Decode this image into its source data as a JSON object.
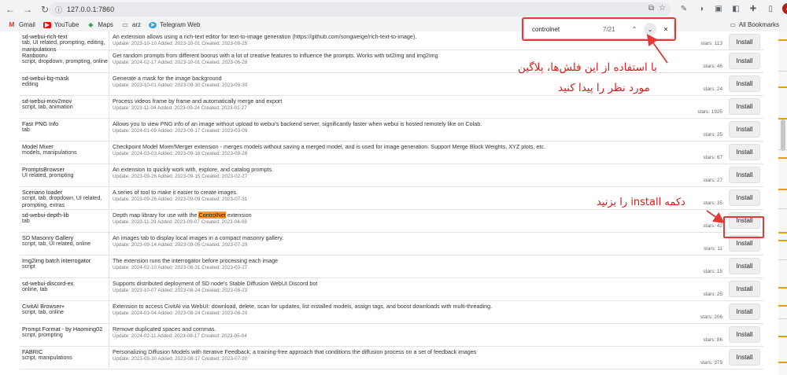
{
  "browser": {
    "url": "127.0.0.1:7860",
    "bookmarks": [
      "Gmail",
      "YouTube",
      "Maps",
      "arz",
      "Telegram Web"
    ],
    "all_bookmarks": "All Bookmarks"
  },
  "find": {
    "query": "controlnet",
    "count": "7/21"
  },
  "annotations": {
    "line1": "با استفاده از این فلش‌ها، پلاگین",
    "line2": "مورد نظر را پیدا کنید",
    "install_hint": "دکمه install را بزنید"
  },
  "install_label": "Install",
  "rows": [
    {
      "name": "sd-webui-rich-text",
      "tags": [
        "tab, UI related, prompting, editing,",
        "manipulations"
      ],
      "desc": "An extension allows using a rich-text editor for text-to-image generation (https://github.com/songweige/rich-text-to-image).",
      "meta": "Update: 2023-10-10 Added: 2023-10-01 Created: 2023-09-25",
      "stars": "stars: 113"
    },
    {
      "name": "Ranbooru",
      "tags": [
        "script, dropdown, prompting, online"
      ],
      "desc": "Get random prompts from different boorus with a lot of creative features to influence the prompts. Works with txt2img and img2img",
      "meta": "Update: 2024-02-17 Added: 2023-10-01 Created: 2023-06-28",
      "stars": "stars: 46"
    },
    {
      "name": "sd-webui-bg-mask",
      "tags": [
        "editing"
      ],
      "desc": "Generate a mask for the image background",
      "meta": "Update: 2023-10-01 Added: 2023-09-30 Created: 2023-09-30",
      "stars": "stars: 24"
    },
    {
      "name": "sd-webui-mov2mov",
      "tags": [
        "script, tab, animation"
      ],
      "desc": "Process videos frame by frame and automatically merge and export",
      "meta": "Update: 2023-11-04 Added: 2023-09-24 Created: 2023-02-27",
      "stars": "stars: 1925"
    },
    {
      "name": "Fast PNG Info",
      "tags": [
        "tab"
      ],
      "desc": "Allows you to view PNG info of an image without upload to webui's backend server, significantly faster when webui is hosted remotely like on Colab.",
      "meta": "Update: 2024-01-09 Added: 2023-09-17 Created: 2023-03-09",
      "stars": "stars: 25"
    },
    {
      "name": "Model Mixer",
      "tags": [
        "models, manipulations"
      ],
      "desc": "Checkpoint Model Mixer/Merger extension - merges models without saving a merged model, and is used for image generation. Support Merge Block Weights, XYZ plots, etc.",
      "meta": "Update: 2024-03-03 Added: 2023-09-16 Created: 2023-09-28",
      "stars": "stars: 67"
    },
    {
      "name": "PromptsBrowser",
      "tags": [
        "UI related, prompting"
      ],
      "desc": "An extension to quickly work with, explore, and catalog prompts.",
      "meta": "Update: 2023-09-26 Added: 2023-09-15 Created: 2023-02-27",
      "stars": "stars: 27"
    },
    {
      "name": "Scenario loader",
      "tags": [
        "script, tab, dropdown, UI related,",
        "prompting, extras"
      ],
      "desc": "A series of tool to make it easier to create images.",
      "meta": "Update: 2023-09-26 Added: 2023-09-09 Created: 2023-07-31",
      "stars": "stars: 35"
    },
    {
      "name": "sd-webui-depth-lib",
      "tags": [
        "tab"
      ],
      "desc_pre": "Depth map library for use with the ",
      "desc_hl": "ControlNet",
      "desc_post": " extension",
      "meta": "Update: 2023-11-29 Added: 2023-09-07 Created: 2023-04-09",
      "stars": "stars: 42"
    },
    {
      "name": "SD Masonry Gallery",
      "tags": [
        "script, tab, UI related, online"
      ],
      "desc": "An images tab to display local images in a compact masonry gallery.",
      "meta": "Update: 2023-09-14 Added: 2023-09-05 Created: 2023-07-20",
      "stars": "stars: 11"
    },
    {
      "name": "Img2img batch interrogator",
      "tags": [
        "script"
      ],
      "desc": "The extension runs the interrogator before processing each image",
      "meta": "Update: 2024-02-10 Added: 2023-08-31 Created: 2023-03-27",
      "stars": "stars: 15"
    },
    {
      "name": "sd-webui-discord-ex",
      "tags": [
        "online, tab"
      ],
      "desc": "Supports distributed deployment of SD node's Stable Diffusion WebUI Discord bot",
      "meta": "Update: 2023-10-07 Added: 2023-08-24 Created: 2023-08-23",
      "stars": "stars: 25"
    },
    {
      "name": "CivitAI Browser+",
      "tags": [
        "script, tab, online"
      ],
      "desc": "Extension to access CivitAI via WebUI: download, delete, scan for updates, list installed models, assign tags, and boost downloads with multi-threading.",
      "meta": "Update: 2024-03-04 Added: 2023-08-24 Created: 2023-08-20",
      "stars": "stars: 206"
    },
    {
      "name": "Prompt Format - by Haoming02",
      "tags": [
        "script, prompting"
      ],
      "desc": "Remove duplicated spaces and commas.",
      "meta": "Update: 2024-02-11 Added: 2023-08-17 Created: 2023-05-04",
      "stars": "stars: 86"
    },
    {
      "name": "FABRIC",
      "tags": [
        "script, manipulations"
      ],
      "desc": "Personalizing Diffusion Models with Iterative Feedback, a training-free approach that conditions the diffusion process on a set of feedback images",
      "meta": "Update: 2023-09-30 Added: 2023-08-17 Created: 2023-07-20",
      "stars": "stars: 375"
    }
  ]
}
